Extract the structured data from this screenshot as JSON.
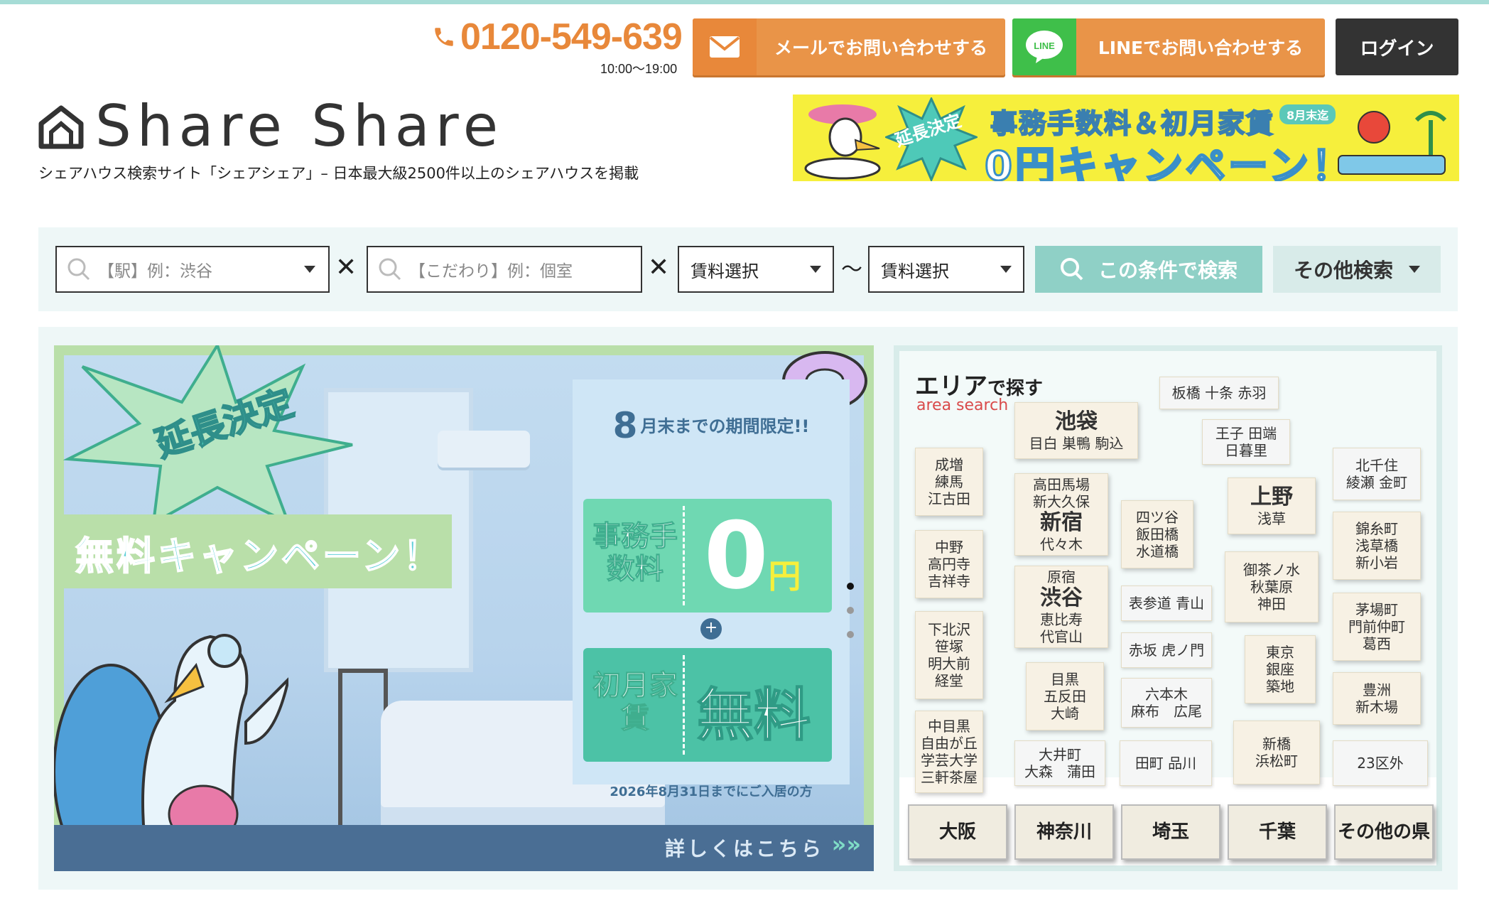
{
  "header": {
    "phone": "0120-549-639",
    "hours": "10:00〜19:00",
    "mail_button": "メールでお問い合わせする",
    "line_button": "LINEでお問い合わせする",
    "line_icon_text": "LINE",
    "login_button": "ログイン"
  },
  "brand": {
    "logo": "Share Share",
    "tagline": "シェアハウス検索サイト「シェアシェア」– 日本最大級2500件以上のシェアハウスを掲載"
  },
  "promo_banner": {
    "burst": "延長決定",
    "line1": "事務手数料＆初月家賃",
    "badge": "8月末迄",
    "line2": "0円キャンペーン！"
  },
  "search": {
    "station_placeholder": "【駅】例：渋谷",
    "kodawari_placeholder": "【こだわり】例：個室",
    "rent_min": "賃料選択",
    "tilde": "〜",
    "rent_max": "賃料選択",
    "go_button": "この条件で検索",
    "other_button": "その他検索"
  },
  "slide": {
    "burst_text": "延長決定",
    "campaign": "無料キャンペーン！",
    "period_num": "8",
    "period_text": "月末までの期間限定!!",
    "ticket1_label": "事務手数料",
    "ticket1_value": "0",
    "ticket1_unit": "円",
    "plus": "+",
    "ticket2_label": "初月家賃",
    "ticket2_value": "無料",
    "footnote": "2026年8月31日までにご入居の方",
    "details": "詳しくはこちら",
    "details_arrow": "»»"
  },
  "area": {
    "title": "エリア",
    "title_suffix": "で探す",
    "subtitle": "area search",
    "tiles": [
      {
        "main": "池袋",
        "sub": "目白 巣鴨 駒込"
      },
      {
        "main": "",
        "sub": "板橋 十条 赤羽"
      },
      {
        "main": "",
        "sub": "王子 田端\n日暮里"
      },
      {
        "main": "",
        "sub": "成増\n練馬\n江古田"
      },
      {
        "main": "新宿",
        "top": "高田馬場\n新大久保",
        "sub": "代々木"
      },
      {
        "main": "",
        "sub": "四ツ谷\n飯田橋\n水道橋"
      },
      {
        "main": "上野",
        "sub": "浅草"
      },
      {
        "main": "",
        "sub": "北千住\n綾瀬 金町"
      },
      {
        "main": "",
        "sub": "中野\n高円寺\n吉祥寺"
      },
      {
        "main": "",
        "sub": "錦糸町\n浅草橋\n新小岩"
      },
      {
        "main": "渋谷",
        "top": "原宿",
        "sub": "恵比寿\n代官山"
      },
      {
        "main": "",
        "sub": "表参道 青山"
      },
      {
        "main": "",
        "sub": "御茶ノ水\n秋葉原\n神田"
      },
      {
        "main": "",
        "sub": "下北沢\n笹塚\n明大前\n経堂"
      },
      {
        "main": "",
        "sub": "茅場町\n門前仲町\n葛西"
      },
      {
        "main": "",
        "sub": "赤坂 虎ノ門"
      },
      {
        "main": "",
        "sub": "東京\n銀座\n築地"
      },
      {
        "main": "",
        "sub": "豊洲\n新木場"
      },
      {
        "main": "",
        "sub": "目黒\n五反田\n大崎"
      },
      {
        "main": "",
        "sub": "六本木\n麻布　広尾"
      },
      {
        "main": "",
        "sub": "中目黒\n自由が丘\n学芸大学\n三軒茶屋"
      },
      {
        "main": "",
        "sub": "大井町\n大森　蒲田"
      },
      {
        "main": "",
        "sub": "田町 品川"
      },
      {
        "main": "",
        "sub": "新橋\n浜松町"
      },
      {
        "main": "",
        "sub": "23区外"
      }
    ],
    "prefectures": [
      "大阪",
      "神奈川",
      "埼玉",
      "千葉",
      "その他の県"
    ]
  },
  "colors": {
    "accent_orange": "#e99448",
    "line_green": "#3fbf4a",
    "teal": "#8fd0c6",
    "dark": "#333333"
  }
}
